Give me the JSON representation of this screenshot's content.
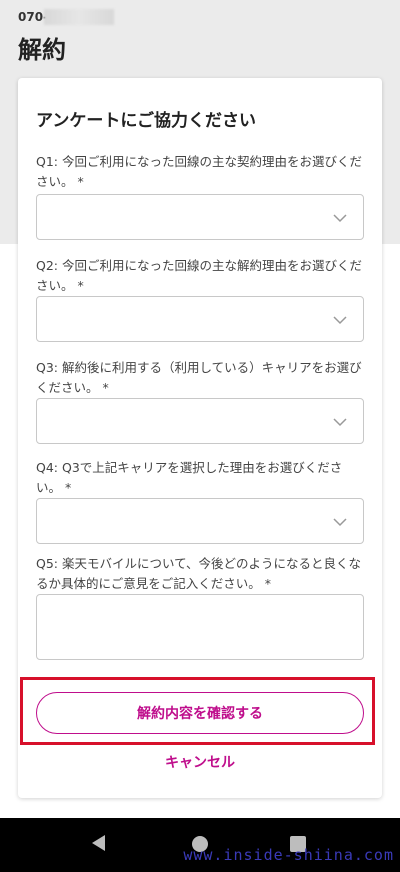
{
  "header": {
    "phone_number": "070-",
    "title": "解約"
  },
  "survey": {
    "title": "アンケートにご協力ください",
    "questions": [
      {
        "label": "Q1: 今回ご利用になった回線の主な契約理由をお選びください。 *",
        "type": "select",
        "value": ""
      },
      {
        "label": "Q2: 今回ご利用になった回線の主な解約理由をお選びください。 *",
        "type": "select",
        "value": ""
      },
      {
        "label": "Q3: 解約後に利用する（利用している）キャリアをお選びください。 *",
        "type": "select",
        "value": ""
      },
      {
        "label": "Q4: Q3で上記キャリアを選択した理由をお選びください。 *",
        "type": "select",
        "value": ""
      },
      {
        "label": "Q5: 楽天モバイルについて、今後どのようになると良くなるか具体的にご意見をご記入ください。 *",
        "type": "textarea",
        "value": ""
      }
    ]
  },
  "actions": {
    "confirm_label": "解約内容を確認する",
    "cancel_label": "キャンセル"
  },
  "watermark": "www.inside-shiina.com",
  "colors": {
    "accent": "#bf0e8c",
    "highlight_frame": "#d7102a",
    "header_bg": "#ebebeb"
  },
  "icons": {
    "select_arrow": "chevron-down-icon",
    "nav_back": "back-triangle-icon",
    "nav_home": "home-circle-icon",
    "nav_recent": "recent-apps-square-icon"
  }
}
